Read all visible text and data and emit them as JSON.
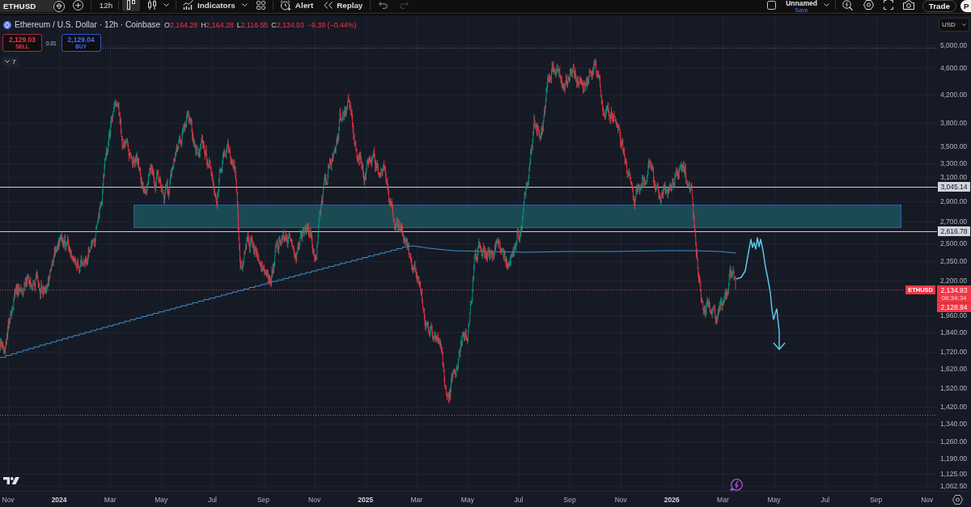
{
  "toolbar": {
    "symbol": "ETHUSD",
    "interval": "12h",
    "chart_types": [
      {
        "kind": "hollow_candles",
        "selected": true
      },
      {
        "kind": "candles",
        "selected": false
      }
    ],
    "indicators": "Indicators",
    "alert": "Alert",
    "replay": "Replay",
    "history": [
      {
        "kind": "undo",
        "disabled": false
      },
      {
        "kind": "redo",
        "disabled": true
      }
    ],
    "layout_name": "Unnamed",
    "layout_status": "Save",
    "trade": "Trade",
    "cut_off_button": "P"
  },
  "legend": {
    "title": "Ethereum / U.S. Dollar · 12h · Coinbase",
    "ohlc": [
      {
        "key": "O",
        "value": "2,164.28"
      },
      {
        "key": "H",
        "value": "2,164.28"
      },
      {
        "key": "L",
        "value": "2,116.55"
      },
      {
        "key": "C",
        "value": "2,134.93"
      }
    ],
    "change": "−9.39 (−0.44%)"
  },
  "order_panel": {
    "sell": {
      "price": "2,129.03",
      "label": "SELL"
    },
    "spread": "0.01",
    "buy": {
      "price": "2,129.04",
      "label": "BUY"
    }
  },
  "indicator_toggle": {
    "count": "7"
  },
  "price_axis": {
    "currency": "USD",
    "labels": [
      "5,000.00",
      "4,600.00",
      "4,200.00",
      "3,800.00",
      "3,500.00",
      "3,300.00",
      "3,100.00",
      "2,900.00",
      "2,700.00",
      "2,500.00",
      "2,350.00",
      "2,200.00",
      "1,960.00",
      "1,840.00",
      "1,720.00",
      "1,620.00",
      "1,520.00",
      "1,420.00",
      "1,340.00",
      "1,260.00",
      "1,190.00",
      "1,125.00",
      "1,062.50"
    ],
    "line_labels": [
      "3,045.14",
      "2,616.78"
    ],
    "last": {
      "symbol": "ETHUSD",
      "price": "2,134.93",
      "countdown": "08:34:34",
      "bid": "2,128.94"
    }
  },
  "time_axis": {
    "labels": [
      {
        "kind": "month",
        "text": "Nov"
      },
      {
        "kind": "year",
        "text": "2024"
      },
      {
        "kind": "month",
        "text": "Mar"
      },
      {
        "kind": "month",
        "text": "May"
      },
      {
        "kind": "month",
        "text": "Jul"
      },
      {
        "kind": "month",
        "text": "Sep"
      },
      {
        "kind": "month",
        "text": "Nov"
      },
      {
        "kind": "year",
        "text": "2025"
      },
      {
        "kind": "month",
        "text": "Mar"
      },
      {
        "kind": "month",
        "text": "May"
      },
      {
        "kind": "month",
        "text": "Jul"
      },
      {
        "kind": "month",
        "text": "Sep"
      },
      {
        "kind": "month",
        "text": "Nov"
      },
      {
        "kind": "year",
        "text": "2026"
      },
      {
        "kind": "month",
        "text": "Mar"
      },
      {
        "kind": "month",
        "text": "May"
      },
      {
        "kind": "month",
        "text": "Jul"
      },
      {
        "kind": "month",
        "text": "Sep"
      },
      {
        "kind": "month",
        "text": "Nov"
      }
    ]
  }
}
